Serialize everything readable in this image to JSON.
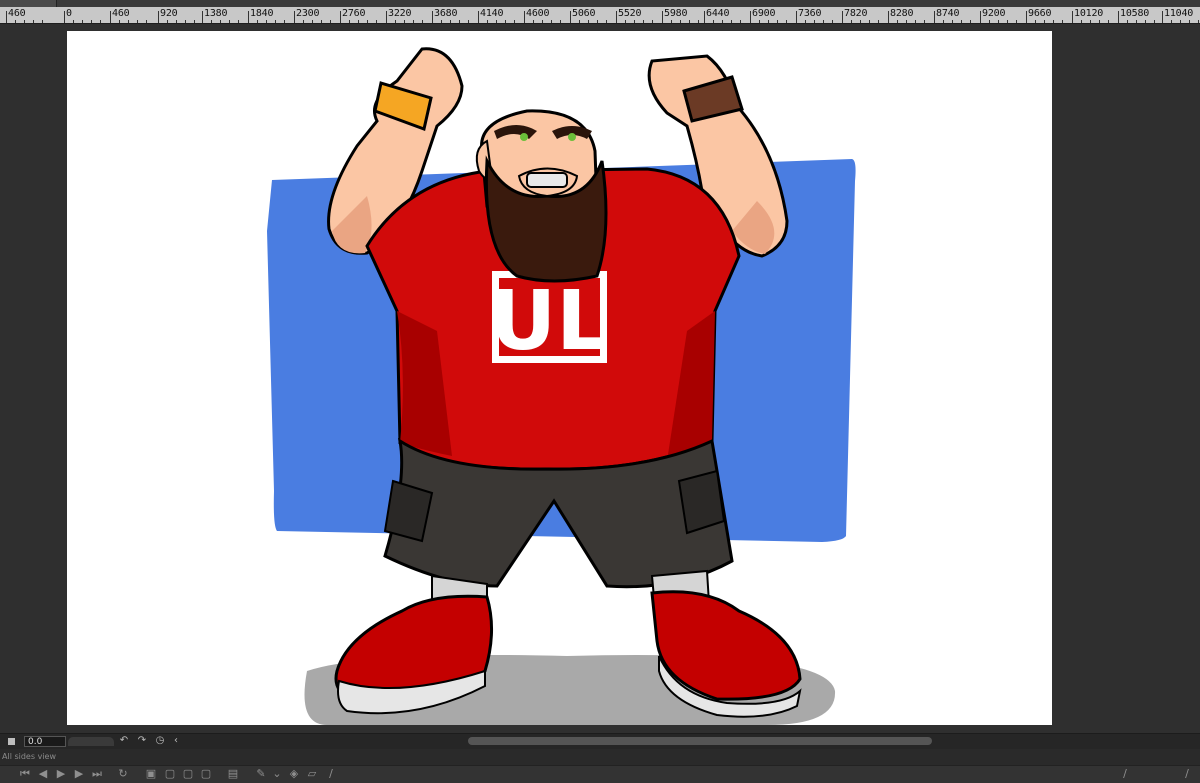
{
  "ruler": {
    "labels": [
      "460",
      "0",
      "460",
      "920",
      "1380",
      "1840",
      "2300",
      "2760",
      "3220",
      "3680",
      "4140",
      "4600",
      "5060",
      "5520",
      "5980",
      "6440",
      "6900",
      "7360",
      "7820",
      "8280",
      "8740",
      "9200",
      "9660",
      "10120",
      "10580",
      "11040"
    ]
  },
  "canvas": {
    "shirt_logo": "UL",
    "colors": {
      "background": "#ffffff",
      "blue_panel": "#4a7de1",
      "shirt": "#d10a0a",
      "shirt_shadow": "#a80000",
      "skin": "#fbc6a4",
      "skin_shadow": "#eaa583",
      "beard": "#3a1a0d",
      "shorts": "#3a3734",
      "shoe": "#c40000",
      "sole": "#e6e6e6",
      "wristband": "#f5a623",
      "watch": "#6b3a25",
      "floor_shadow": "#a9a9a9"
    }
  },
  "timeline": {
    "frame_value": "0.0"
  },
  "view": {
    "label": "All sides view"
  },
  "toolbar": {
    "icons": [
      "first-frame-icon",
      "prev-frame-icon",
      "play-icon",
      "next-frame-icon",
      "last-frame-icon",
      "loop-icon",
      "frame-view-icon",
      "onion-prev-icon",
      "onion-next-icon",
      "onion-range-icon",
      "camera-view-icon",
      "pen-tool-icon",
      "dropdown-icon",
      "fill-tool-icon",
      "shape-tool-icon",
      "brush-tool-icon",
      "stroke-right-1-icon",
      "stroke-right-2-icon"
    ]
  }
}
